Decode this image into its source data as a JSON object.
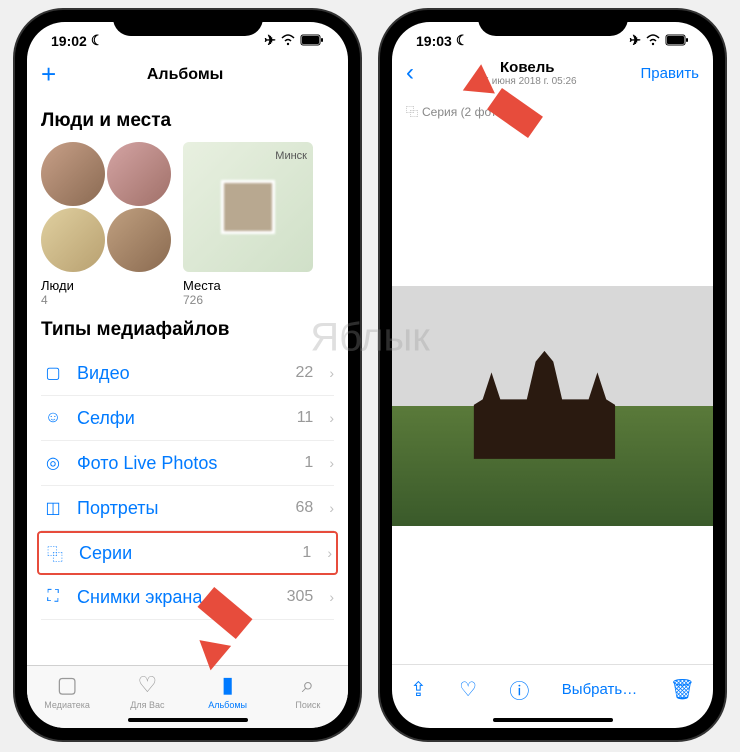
{
  "watermark": "Яблык",
  "phone_left": {
    "status": {
      "time": "19:02",
      "moon": "☾"
    },
    "nav": {
      "add": "+",
      "title": "Альбомы"
    },
    "section1_title": "Люди и места",
    "map_city": "Минск",
    "people_label": "Люди",
    "people_count": "4",
    "places_label": "Места",
    "places_count": "726",
    "section2_title": "Типы медиафайлов",
    "media": [
      {
        "icon": "video-icon",
        "glyph": "▢",
        "label": "Видео",
        "count": "22"
      },
      {
        "icon": "selfie-icon",
        "glyph": "☺",
        "label": "Селфи",
        "count": "11"
      },
      {
        "icon": "livephoto-icon",
        "glyph": "◎",
        "label": "Фото Live Photos",
        "count": "1"
      },
      {
        "icon": "portrait-icon",
        "glyph": "◫",
        "label": "Портреты",
        "count": "68"
      },
      {
        "icon": "burst-icon",
        "glyph": "⿻",
        "label": "Серии",
        "count": "1",
        "highlighted": true
      },
      {
        "icon": "screenshot-icon",
        "glyph": "⛶",
        "label": "Снимки экрана",
        "count": "305"
      }
    ],
    "tabs": [
      {
        "icon": "▢",
        "label": "Медиатека"
      },
      {
        "icon": "♡",
        "label": "Для Вас"
      },
      {
        "icon": "▮",
        "label": "Альбомы",
        "active": true
      },
      {
        "icon": "⌕",
        "label": "Поиск"
      }
    ]
  },
  "phone_right": {
    "status": {
      "time": "19:03",
      "moon": "☾"
    },
    "nav": {
      "back": "‹",
      "title": "Ковель",
      "subtitle": "25 июня 2018 г.  05:26",
      "edit": "Править"
    },
    "burst_label": "Серия (2 фото)",
    "toolbar": {
      "share": "⇪",
      "favorite": "♡",
      "info": "ⓘ",
      "select": "Выбрать…",
      "trash": "🗑"
    }
  }
}
